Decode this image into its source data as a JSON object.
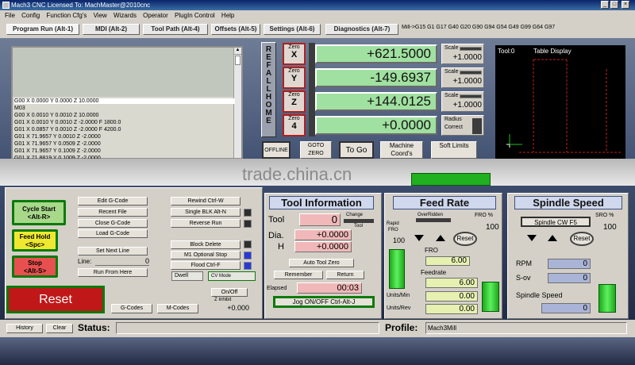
{
  "window": {
    "title": "Mach3 CNC  Licensed To: MachMaster@2010cnc"
  },
  "menu": [
    "File",
    "Config",
    "Function Cfg's",
    "View",
    "Wizards",
    "Operator",
    "PlugIn Control",
    "Help"
  ],
  "tabs": [
    {
      "label": "Program Run (Alt-1)"
    },
    {
      "label": "MDI (Alt-2)"
    },
    {
      "label": "Tool Path (Alt-4)"
    },
    {
      "label": "Offsets (Alt-5)"
    },
    {
      "label": "Settings (Alt-6)"
    },
    {
      "label": "Diagnostics (Alt-7)"
    }
  ],
  "modal_gcodes": "Mill->G15  G1 G17 G40 G20 G90 G94 G54 G49 G99 G64 G97",
  "gcode": {
    "lines": [
      "G00 X 0.0000 Y 0.0000 Z 10.0000",
      "M03",
      "G00 X 0.0010 Y 0.0010 Z 10.0000",
      "G01 X 0.0010 Y 0.0010 Z -2.0000 F 1800.0",
      "G01 X 0.0857 Y 0.0010 Z -2.0000 F 4200.0",
      "G01 X 71.9657 Y 0.0010 Z -2.0000",
      "G01 X 71.9657 Y 0.0509 Z -2.0000",
      "G01 X 71.9657 Y 0.1009 Z -2.0000",
      "G01 X 71.8819 Y 0.1009 Z -2.0000"
    ]
  },
  "refhome": "REF ALL HOME",
  "axes": [
    {
      "zero": "Zero",
      "axis": "X",
      "value": "+621.5000",
      "scale_label": "Scale",
      "scale": "+1.0000"
    },
    {
      "zero": "Zero",
      "axis": "Y",
      "value": "-149.6937",
      "scale_label": "Scale",
      "scale": "+1.0000"
    },
    {
      "zero": "Zero",
      "axis": "Z",
      "value": "+144.0125",
      "scale_label": "Scale",
      "scale": "+1.0000"
    },
    {
      "zero": "Zero",
      "axis": "4",
      "value": "+0.0000",
      "scale_label": "Radius",
      "scale": "Correct"
    }
  ],
  "dro_buttons": {
    "offline": "OFFLINE",
    "goto_zero": "GOTO ZERO",
    "to_go": "To Go",
    "machine_coords": "Machine Coord's",
    "soft_limits": "Soft Limits"
  },
  "toolpath": {
    "tool_label": "Tool:0",
    "title": "Table Display"
  },
  "watermark": "trade.china.cn",
  "left_controls": {
    "cycle_start": "Cycle Start",
    "cycle_start_key": "<Alt-R>",
    "feed_hold": "Feed Hold",
    "feed_hold_key": "<Spc>",
    "stop": "Stop",
    "stop_key": "<Alt-S>",
    "reset": "Reset"
  },
  "file_buttons": {
    "edit_gcode": "Edit G-Code",
    "recent_file": "Recent File",
    "close_gcode": "Close G-Code",
    "load_gcode": "Load G-Code",
    "set_next_line": "Set Next Line",
    "line_label": "Line:",
    "line_value": "0",
    "run_from_here": "Run From Here",
    "gcodes": "G-Codes",
    "mcodes": "M-Codes"
  },
  "run_buttons": {
    "rewind": "Rewind Ctrl-W",
    "single_blk": "Single BLK Alt-N",
    "reverse_run": "Reverse Run",
    "block_delete": "Block Delete",
    "m1_optional_stop": "M1 Optional Stop",
    "flood": "Flood Ctrl-F",
    "dwell": "Dwell",
    "cv_mode": "CV Mode",
    "on_off": "On/Off",
    "z_inhibit": "Z Inhibit",
    "z_inhibit_value": "+0.000"
  },
  "tool_info": {
    "title": "Tool Information",
    "tool_label": "Tool",
    "tool_value": "0",
    "change_label": "Change",
    "tool_small": "Tool",
    "dia_label": "Dia.",
    "dia_value": "+0.0000",
    "h_label": "H",
    "h_value": "+0.0000",
    "auto_tool_zero": "Auto Tool Zero",
    "remember": "Remember",
    "return": "Return",
    "elapsed_label": "Elapsed",
    "elapsed_value": "00:03",
    "jog": "Jog ON/OFF Ctrl-Alt-J"
  },
  "feed_rate": {
    "title": "Feed Rate",
    "overridden": "OverRidden",
    "fro_pct_label": "FRO %",
    "fro_pct_value": "100",
    "rapid_label": "Rapid",
    "rapid_fro": "FRO",
    "rapid_value": "100",
    "reset": "Reset",
    "fro_label": "FRO",
    "fro_value": "6.00",
    "feedrate_label": "Feedrate",
    "feedrate_value": "6.00",
    "units_min_label": "Units/Min",
    "units_min_value": "0.00",
    "units_rev_label": "Units/Rev",
    "units_rev_value": "0.00"
  },
  "spindle": {
    "title": "Spindle Speed",
    "cw_button": "Spindle CW F5",
    "sro_pct_label": "SRO %",
    "sro_pct_value": "100",
    "reset": "Reset",
    "rpm_label": "RPM",
    "rpm_value": "0",
    "sov_label": "S-ov",
    "sov_value": "0",
    "speed_label": "Spindle Speed",
    "speed_value": "0"
  },
  "status": {
    "history": "History",
    "clear": "Clear",
    "status_label": "Status:",
    "profile_label": "Profile:",
    "profile_value": "Mach3Mill"
  },
  "colors": {
    "dro_green": "#a0e0a0",
    "zero_border": "#b02020",
    "panel_header": "#cfd8ec"
  }
}
